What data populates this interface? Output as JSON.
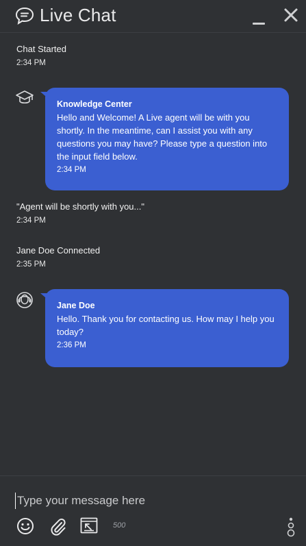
{
  "header": {
    "title": "Live Chat"
  },
  "messages": {
    "chat_started": {
      "text": "Chat Started",
      "time": "2:34 PM"
    },
    "bot": {
      "sender": "Knowledge Center",
      "text": "Hello and Welcome! A Live agent will be with you shortly. In the meantime, can I assist you with any questions you may have? Please type a question into the input field below.",
      "time": "2:34 PM"
    },
    "agent_wait": {
      "text": "\"Agent will be shortly with you...\"",
      "time": "2:34 PM"
    },
    "agent_connected": {
      "text": "Jane Doe Connected",
      "time": "2:35 PM"
    },
    "agent": {
      "sender": "Jane Doe",
      "text": "Hello. Thank you for contacting us. How may I help you today?",
      "time": "2:36 PM"
    }
  },
  "composer": {
    "placeholder": "Type your message here",
    "value": "",
    "char_limit": "500"
  },
  "colors": {
    "background": "#2f3134",
    "bubble": "#3b5fd1"
  }
}
